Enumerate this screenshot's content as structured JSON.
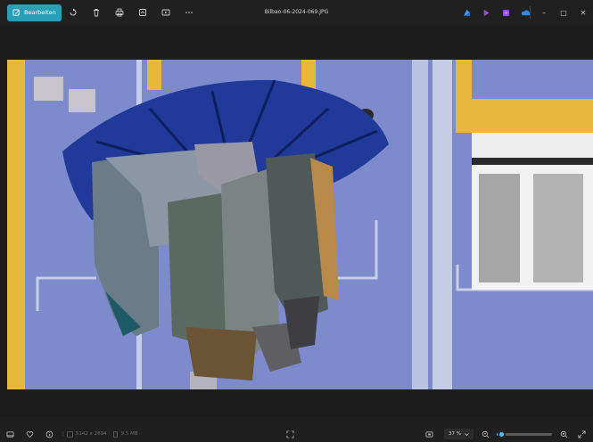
{
  "toolbar": {
    "edit_label": "Bearbeiten",
    "icons": [
      "rotate-icon",
      "delete-icon",
      "print-icon",
      "gallery-icon",
      "slideshow-icon",
      "more-icon"
    ]
  },
  "title": "Bilbao-06-2024-069.JPG",
  "right_apps": [
    "clipchamp-icon",
    "designer-icon",
    "app-icon",
    "onedrive-icon"
  ],
  "window": {
    "minimize": "–",
    "maximize": "□",
    "close": "✕"
  },
  "status": {
    "dimensions": "5142 x 2894",
    "file_size": "9.5 MB"
  },
  "zoom": {
    "value": "37 %",
    "level": 0.08
  },
  "colors": {
    "accent": "#2b9fb8",
    "slider": "#4cc2ff",
    "background": "#1f1f1f"
  }
}
